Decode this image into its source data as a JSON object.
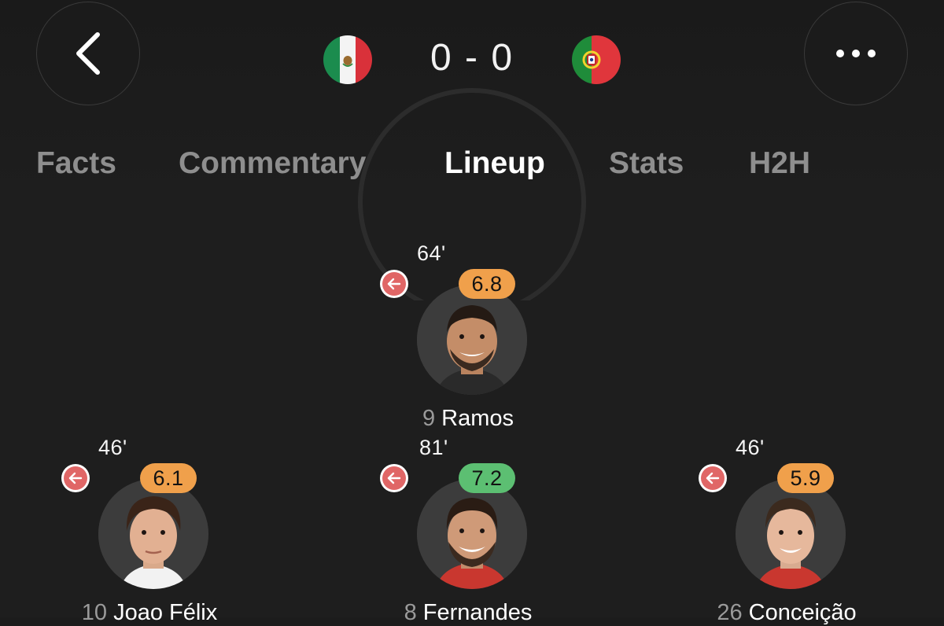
{
  "match": {
    "home_flag": "mexico-flag-icon",
    "away_flag": "portugal-flag-icon",
    "score": "0 - 0"
  },
  "tabs": [
    {
      "label": "Facts",
      "active": false
    },
    {
      "label": "Commentary",
      "active": false
    },
    {
      "label": "Lineup",
      "active": true
    },
    {
      "label": "Stats",
      "active": false
    },
    {
      "label": "H2H",
      "active": false
    }
  ],
  "colors": {
    "rating_orange": "#f0a04b",
    "rating_green": "#5cbf72",
    "sub_red": "#e06666"
  },
  "players": [
    {
      "minute": "64'",
      "rating": "6.8",
      "rating_color": "orange",
      "number": "9",
      "name": "Ramos"
    },
    {
      "minute": "46'",
      "rating": "6.1",
      "rating_color": "orange",
      "number": "10",
      "name": "Joao Félix"
    },
    {
      "minute": "81'",
      "rating": "7.2",
      "rating_color": "green",
      "number": "8",
      "name": "Fernandes"
    },
    {
      "minute": "46'",
      "rating": "5.9",
      "rating_color": "orange",
      "number": "26",
      "name": "Conceição"
    }
  ]
}
